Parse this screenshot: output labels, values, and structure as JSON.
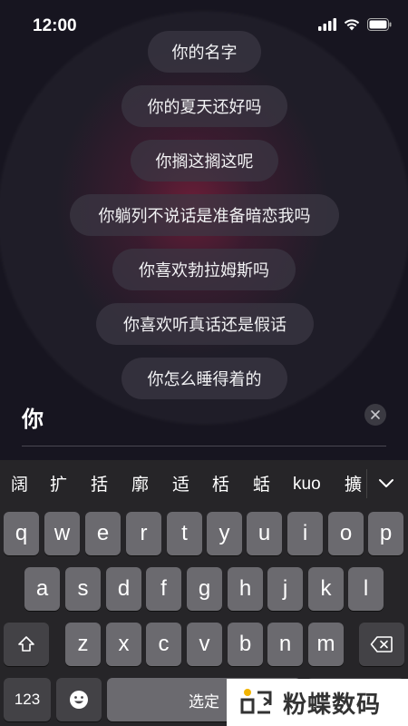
{
  "status_bar": {
    "time": "12:00",
    "icons": [
      "signal-icon",
      "wifi-icon",
      "battery-icon"
    ]
  },
  "suggestions": [
    "你的名字",
    "你的夏天还好吗",
    "你搁这搁这呢",
    "你躺列不说话是准备暗恋我吗",
    "你喜欢勃拉姆斯吗",
    "你喜欢听真话还是假话",
    "你怎么睡得着的"
  ],
  "input": {
    "value": "你",
    "clear_icon": "close-icon"
  },
  "keyboard": {
    "candidates": [
      "阔",
      "扩",
      "括",
      "廓",
      "适",
      "栝",
      "蛞",
      "kuo",
      "擴"
    ],
    "expand_icon": "chevron-down-icon",
    "row1": [
      "q",
      "w",
      "e",
      "r",
      "t",
      "y",
      "u",
      "i",
      "o",
      "p"
    ],
    "row2": [
      "a",
      "s",
      "d",
      "f",
      "g",
      "h",
      "j",
      "k",
      "l"
    ],
    "row3": [
      "z",
      "x",
      "c",
      "v",
      "b",
      "n",
      "m"
    ],
    "shift_icon": "shift-icon",
    "delete_icon": "delete-icon",
    "numbers_label": "123",
    "emoji_icon": "emoji-icon",
    "space_label": "选定"
  },
  "watermark": {
    "text": "粉蝶数码",
    "logo": "watermark-logo"
  },
  "colors": {
    "background": "#171520",
    "glow": "#821e3c",
    "pill": "#3c3844",
    "key": "#6b6a6f",
    "key_fn": "#434246",
    "keyboard_bg": "#262528"
  }
}
